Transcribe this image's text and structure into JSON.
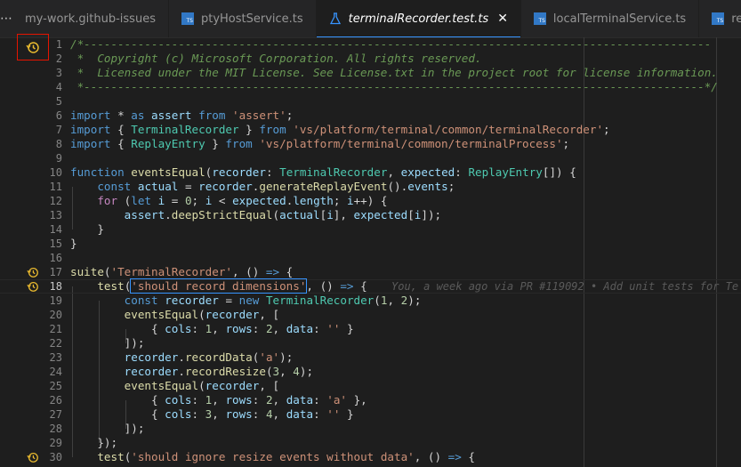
{
  "tabs": [
    {
      "label": "my-work.github-issues",
      "icon": "none"
    },
    {
      "label": "ptyHostService.ts",
      "icon": "typescript-icon"
    },
    {
      "label": "terminalRecorder.test.ts",
      "icon": "flask-icon",
      "active": true
    },
    {
      "label": "localTerminalService.ts",
      "icon": "typescript-icon"
    },
    {
      "label": "remoteTerm",
      "icon": "typescript-icon"
    }
  ],
  "tabbar": {
    "overflow": "⋯",
    "close": "✕",
    "ts_badge": "TS"
  },
  "blame": "You, a week ago via PR #119092 • Add unit tests for Te",
  "lines": [
    {
      "n": "1",
      "code": "/*---------------------------------------------------------------------------------------------"
    },
    {
      "n": "2",
      "code": " *  Copyright (c) Microsoft Corporation. All rights reserved."
    },
    {
      "n": "3",
      "code": " *  Licensed under the MIT License. See License.txt in the project root for license information."
    },
    {
      "n": "4",
      "code": " *--------------------------------------------------------------------------------------------*/"
    },
    {
      "n": "5",
      "code": ""
    },
    {
      "n": "6",
      "code": "import * as assert from 'assert';"
    },
    {
      "n": "7",
      "code": "import { TerminalRecorder } from 'vs/platform/terminal/common/terminalRecorder';"
    },
    {
      "n": "8",
      "code": "import { ReplayEntry } from 'vs/platform/terminal/common/terminalProcess';"
    },
    {
      "n": "9",
      "code": ""
    },
    {
      "n": "10",
      "code": "function eventsEqual(recorder: TerminalRecorder, expected: ReplayEntry[]) {"
    },
    {
      "n": "11",
      "code": "    const actual = recorder.generateReplayEvent().events;"
    },
    {
      "n": "12",
      "code": "    for (let i = 0; i < expected.length; i++) {"
    },
    {
      "n": "13",
      "code": "        assert.deepStrictEqual(actual[i], expected[i]);"
    },
    {
      "n": "14",
      "code": "    }"
    },
    {
      "n": "15",
      "code": "}"
    },
    {
      "n": "16",
      "code": ""
    },
    {
      "n": "17",
      "code": "suite('TerminalRecorder', () => {"
    },
    {
      "n": "18",
      "code": "    test('should record dimensions', () => {"
    },
    {
      "n": "19",
      "code": "        const recorder = new TerminalRecorder(1, 2);"
    },
    {
      "n": "20",
      "code": "        eventsEqual(recorder, ["
    },
    {
      "n": "21",
      "code": "            { cols: 1, rows: 2, data: '' }"
    },
    {
      "n": "22",
      "code": "        ]);"
    },
    {
      "n": "23",
      "code": "        recorder.recordData('a');"
    },
    {
      "n": "24",
      "code": "        recorder.recordResize(3, 4);"
    },
    {
      "n": "25",
      "code": "        eventsEqual(recorder, ["
    },
    {
      "n": "26",
      "code": "            { cols: 1, rows: 2, data: 'a' },"
    },
    {
      "n": "27",
      "code": "            { cols: 3, rows: 4, data: '' }"
    },
    {
      "n": "28",
      "code": "        ]);"
    },
    {
      "n": "29",
      "code": "    });"
    },
    {
      "n": "30",
      "code": "    test('should ignore resize events without data', () => {"
    }
  ],
  "colors": {
    "background": "#1e1e1e",
    "accent": "#3794ff",
    "comment": "#6a9955",
    "keyword": "#569cd6",
    "string": "#ce9178",
    "function": "#dcdcaa",
    "type": "#4ec9b0",
    "history": "#e8b92f",
    "highlight_border": "#e51400"
  }
}
